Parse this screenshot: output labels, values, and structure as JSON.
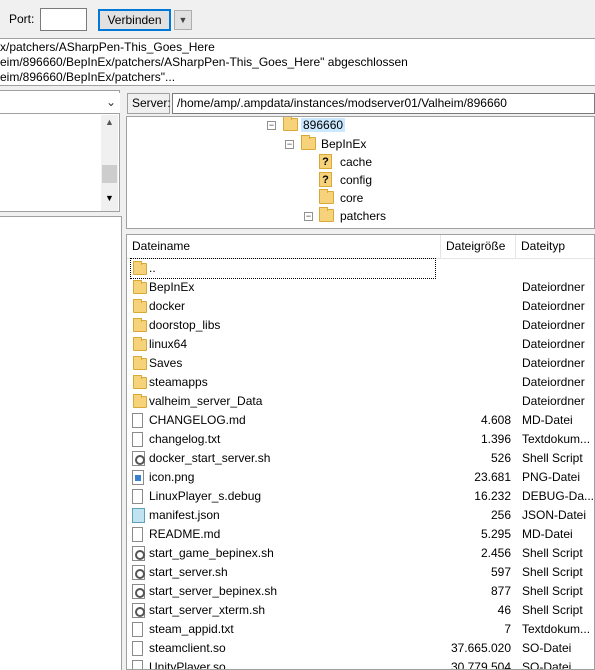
{
  "quickconnect": {
    "port_label": "Port:",
    "port_value": "",
    "connect_label": "Verbinden",
    "dropdown_icon": "chevron-down-icon"
  },
  "log": {
    "lines": [
      "x/patchers/ASharpPen-This_Goes_Here",
      "eim/896660/BepInEx/patchers/ASharpPen-This_Goes_Here\" abgeschlossen",
      "eim/896660/BepInEx/patchers\"..."
    ]
  },
  "local": {
    "combo_value": ""
  },
  "remote": {
    "server_label": "Server:",
    "path": "/home/amp/.ampdata/instances/modserver01/Valheim/896660",
    "tree": [
      {
        "label": "896660",
        "expander": "-",
        "icon": "folder",
        "selected": true
      },
      {
        "label": "BepInEx",
        "expander": "-",
        "icon": "folder",
        "selected": false
      },
      {
        "label": "cache",
        "expander": "",
        "icon": "unknown",
        "selected": false
      },
      {
        "label": "config",
        "expander": "",
        "icon": "unknown",
        "selected": false
      },
      {
        "label": "core",
        "expander": "",
        "icon": "folder",
        "selected": false
      },
      {
        "label": "patchers",
        "expander": "-",
        "icon": "folder",
        "selected": false
      }
    ],
    "columns": {
      "name": "Dateiname",
      "size": "Dateigröße",
      "type": "Dateityp"
    },
    "files": [
      {
        "name": "..",
        "size": "",
        "type": "",
        "icon": "folder"
      },
      {
        "name": "BepInEx",
        "size": "",
        "type": "Dateiordner",
        "icon": "folder"
      },
      {
        "name": "docker",
        "size": "",
        "type": "Dateiordner",
        "icon": "folder"
      },
      {
        "name": "doorstop_libs",
        "size": "",
        "type": "Dateiordner",
        "icon": "folder"
      },
      {
        "name": "linux64",
        "size": "",
        "type": "Dateiordner",
        "icon": "folder"
      },
      {
        "name": "Saves",
        "size": "",
        "type": "Dateiordner",
        "icon": "folder"
      },
      {
        "name": "steamapps",
        "size": "",
        "type": "Dateiordner",
        "icon": "folder"
      },
      {
        "name": "valheim_server_Data",
        "size": "",
        "type": "Dateiordner",
        "icon": "folder"
      },
      {
        "name": "CHANGELOG.md",
        "size": "4.608",
        "type": "MD-Datei",
        "icon": "doc"
      },
      {
        "name": "changelog.txt",
        "size": "1.396",
        "type": "Textdokum...",
        "icon": "doc"
      },
      {
        "name": "docker_start_server.sh",
        "size": "526",
        "type": "Shell Script",
        "icon": "script"
      },
      {
        "name": "icon.png",
        "size": "23.681",
        "type": "PNG-Datei",
        "icon": "image"
      },
      {
        "name": "LinuxPlayer_s.debug",
        "size": "16.232",
        "type": "DEBUG-Da...",
        "icon": "doc"
      },
      {
        "name": "manifest.json",
        "size": "256",
        "type": "JSON-Datei",
        "icon": "json"
      },
      {
        "name": "README.md",
        "size": "5.295",
        "type": "MD-Datei",
        "icon": "doc"
      },
      {
        "name": "start_game_bepinex.sh",
        "size": "2.456",
        "type": "Shell Script",
        "icon": "script"
      },
      {
        "name": "start_server.sh",
        "size": "597",
        "type": "Shell Script",
        "icon": "script"
      },
      {
        "name": "start_server_bepinex.sh",
        "size": "877",
        "type": "Shell Script",
        "icon": "script"
      },
      {
        "name": "start_server_xterm.sh",
        "size": "46",
        "type": "Shell Script",
        "icon": "script"
      },
      {
        "name": "steam_appid.txt",
        "size": "7",
        "type": "Textdokum...",
        "icon": "doc"
      },
      {
        "name": "steamclient.so",
        "size": "37.665.020",
        "type": "SO-Datei",
        "icon": "doc"
      },
      {
        "name": "UnityPlayer.so",
        "size": "30.779.504",
        "type": "SO-Datei",
        "icon": "doc"
      }
    ]
  }
}
